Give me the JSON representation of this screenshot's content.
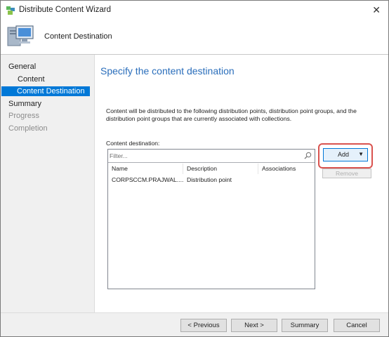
{
  "window": {
    "title": "Distribute Content Wizard",
    "close_glyph": "✕"
  },
  "header": {
    "title": "Content Destination",
    "icon": "computer-monitor-icon"
  },
  "nav": {
    "items": [
      {
        "label": "General",
        "state": "normal"
      },
      {
        "label": "Content",
        "state": "normal"
      },
      {
        "label": "Content Destination",
        "state": "selected"
      },
      {
        "label": "Summary",
        "state": "normal"
      },
      {
        "label": "Progress",
        "state": "disabled"
      },
      {
        "label": "Completion",
        "state": "disabled"
      }
    ]
  },
  "main": {
    "heading": "Specify the content destination",
    "description": "Content will be distributed to the following distribution points, distribution point groups, and the distribution point groups that are currently associated with collections.",
    "destination_label": "Content destination:",
    "filter_placeholder": "Filter...",
    "columns": [
      "Name",
      "Description",
      "Associations"
    ],
    "rows": [
      {
        "name": "CORPSCCM.PRAJWAL....",
        "description": "Distribution point",
        "associations": ""
      }
    ],
    "add_label": "Add",
    "add_caret": "▼",
    "remove_label": "Remove"
  },
  "footer": {
    "previous": "< Previous",
    "next": "Next >",
    "summary": "Summary",
    "cancel": "Cancel"
  },
  "colors": {
    "accent": "#0078d7",
    "heading": "#2a6ebb",
    "highlight_border": "#d9534f"
  }
}
